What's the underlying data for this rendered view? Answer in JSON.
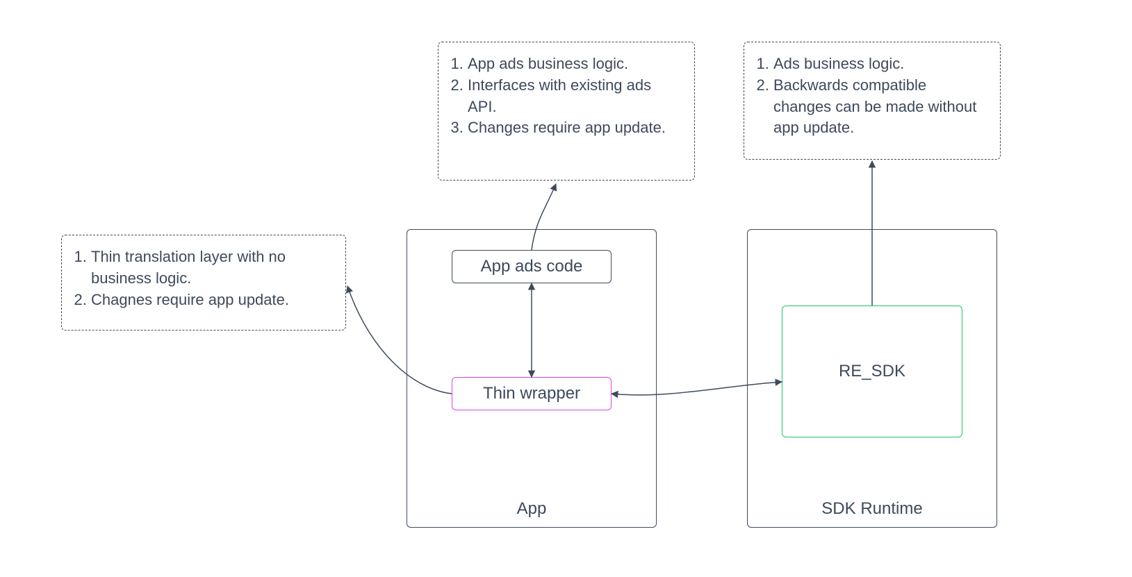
{
  "notes": {
    "left": {
      "item1": "Thin translation layer with no business logic.",
      "item2": "Chagnes require app update."
    },
    "top_center": {
      "item1": "App ads business logic.",
      "item2": "Interfaces with existing ads API.",
      "item3": "Changes require app update."
    },
    "top_right": {
      "item1": "Ads business logic.",
      "item2": "Backwards compatible changes can be made without app update."
    }
  },
  "containers": {
    "app": {
      "label": "App"
    },
    "sdk_runtime": {
      "label": "SDK Runtime"
    }
  },
  "nodes": {
    "app_ads_code": {
      "label": "App ads code"
    },
    "thin_wrapper": {
      "label": "Thin wrapper"
    },
    "re_sdk": {
      "label": "RE_SDK"
    }
  }
}
